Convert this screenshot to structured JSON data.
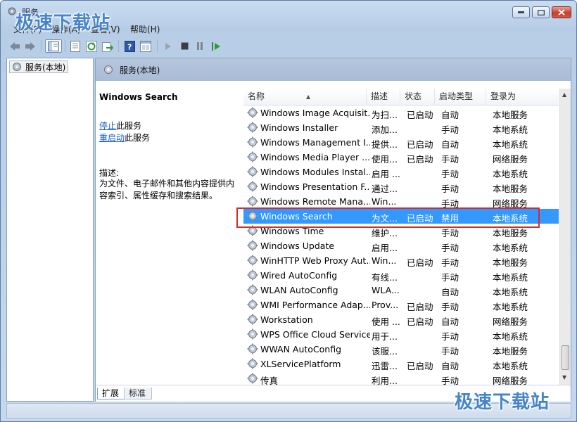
{
  "window": {
    "title": "服务",
    "controls": {
      "minimize": "minimize",
      "maximize": "maximize",
      "close": "close"
    }
  },
  "menu": [
    "文件(F)",
    "操作(A)",
    "查看(V)",
    "帮助(H)"
  ],
  "toolbar": {
    "icons": [
      "back-icon",
      "forward-icon",
      "show-tree-icon",
      "properties-icon",
      "refresh-icon",
      "export-icon",
      "help-icon",
      "console-icon",
      "start-icon",
      "stop-icon",
      "pause-icon",
      "restart-icon"
    ]
  },
  "tree": {
    "root_label": "服务(本地)"
  },
  "pane": {
    "header": "服务(本地)"
  },
  "details": {
    "service_title": "Windows Search",
    "stop_link": "停止",
    "stop_suffix": "此服务",
    "restart_link": "重启动",
    "restart_suffix": "此服务",
    "desc_label": "描述:",
    "desc_text": "为文件、电子邮件和其他内容提供内容索引、属性缓存和搜索结果。"
  },
  "columns": [
    "名称",
    "描述",
    "状态",
    "启动类型",
    "登录为"
  ],
  "services": [
    {
      "name": "Windows Image Acquisit...",
      "desc": "为扫...",
      "status": "已启动",
      "startup": "自动",
      "logon": "本地服务"
    },
    {
      "name": "Windows Installer",
      "desc": "添加...",
      "status": "",
      "startup": "手动",
      "logon": "本地系统"
    },
    {
      "name": "Windows Management I...",
      "desc": "提供...",
      "status": "已启动",
      "startup": "自动",
      "logon": "本地系统"
    },
    {
      "name": "Windows Media Player ...",
      "desc": "使用...",
      "status": "已启动",
      "startup": "手动",
      "logon": "网络服务"
    },
    {
      "name": "Windows Modules Instal...",
      "desc": "启用 ...",
      "status": "",
      "startup": "手动",
      "logon": "本地系统"
    },
    {
      "name": "Windows Presentation F...",
      "desc": "通过...",
      "status": "",
      "startup": "手动",
      "logon": "本地服务"
    },
    {
      "name": "Windows Remote Mana...",
      "desc": "Win...",
      "status": "",
      "startup": "手动",
      "logon": "网络服务"
    },
    {
      "name": "Windows Search",
      "desc": "为文...",
      "status": "已启动",
      "startup": "禁用",
      "logon": "本地系统"
    },
    {
      "name": "Windows Time",
      "desc": "维护...",
      "status": "",
      "startup": "手动",
      "logon": "本地服务"
    },
    {
      "name": "Windows Update",
      "desc": "启用...",
      "status": "",
      "startup": "手动",
      "logon": "本地系统"
    },
    {
      "name": "WinHTTP Web Proxy Aut...",
      "desc": "Win...",
      "status": "已启动",
      "startup": "手动",
      "logon": "本地服务"
    },
    {
      "name": "Wired AutoConfig",
      "desc": "有线...",
      "status": "",
      "startup": "手动",
      "logon": "本地系统"
    },
    {
      "name": "WLAN AutoConfig",
      "desc": "WLA...",
      "status": "",
      "startup": "自动",
      "logon": "本地系统"
    },
    {
      "name": "WMI Performance Adap...",
      "desc": "Prov...",
      "status": "已启动",
      "startup": "手动",
      "logon": "本地系统"
    },
    {
      "name": "Workstation",
      "desc": "使用 ...",
      "status": "已启动",
      "startup": "自动",
      "logon": "网络服务"
    },
    {
      "name": "WPS Office Cloud Service",
      "desc": "用于...",
      "status": "",
      "startup": "手动",
      "logon": "本地系统"
    },
    {
      "name": "WWAN AutoConfig",
      "desc": "该服...",
      "status": "",
      "startup": "手动",
      "logon": "本地服务"
    },
    {
      "name": "XLServicePlatform",
      "desc": "迅雷...",
      "status": "已启动",
      "startup": "自动",
      "logon": "本地系统"
    },
    {
      "name": "传真",
      "desc": "利用...",
      "status": "",
      "startup": "手动",
      "logon": "网络服务"
    }
  ],
  "selected_service": "Windows Search",
  "tabs": [
    "扩展",
    "标准"
  ],
  "watermark": "极速下载站",
  "colors": {
    "selection": "#3399ff",
    "highlight_border": "#d62b2b",
    "link": "#1b5bbf"
  }
}
